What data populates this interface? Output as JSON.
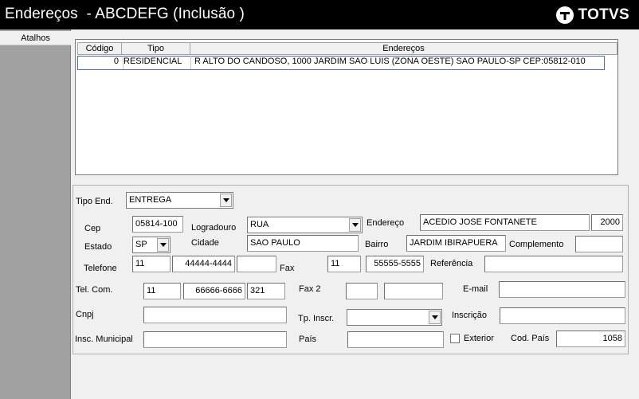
{
  "title": "Endereços  - ABCDEFG (Inclusão )",
  "logo": {
    "text": "TOTVS"
  },
  "sidebar": {
    "label": "Atalhos"
  },
  "grid": {
    "columns": [
      "Código",
      "Tipo",
      "Endereços"
    ],
    "rows": [
      {
        "codigo": "0",
        "tipo": "RESIDENCIAL",
        "endereco": "R  ALTO DO CANDOSO, 1000 JARDIM SAO LUIS (ZONA OESTE) SAO PAULO-SP CEP:05812-010"
      }
    ]
  },
  "form": {
    "tipo_end": {
      "label": "Tipo End.",
      "value": "ENTREGA"
    },
    "cep": {
      "label": "Cep",
      "value": "05814-100"
    },
    "logradouro": {
      "label": "Logradouro",
      "value": "RUA"
    },
    "endereco": {
      "label": "Endereço",
      "value": "ACEDIO JOSE FONTANETE",
      "numero": "2000"
    },
    "estado": {
      "label": "Estado",
      "value": "SP"
    },
    "cidade": {
      "label": "Cidade",
      "value": "SAO PAULO"
    },
    "bairro": {
      "label": "Bairro",
      "value": "JARDIM IBIRAPUERA"
    },
    "complemento": {
      "label": "Complemento",
      "value": ""
    },
    "telefone": {
      "label": "Telefone",
      "ddd": "11",
      "numero": "44444-4444",
      "ramal": ""
    },
    "fax": {
      "label": "Fax",
      "ddd": "11",
      "numero": "55555-5555"
    },
    "referencia": {
      "label": "Referência",
      "value": ""
    },
    "tel_com": {
      "label": "Tel. Com.",
      "ddd": "11",
      "numero": "66666-6666",
      "ramal": "321"
    },
    "fax2": {
      "label": "Fax 2",
      "ddd": "",
      "numero": ""
    },
    "email": {
      "label": "E-mail",
      "value": ""
    },
    "cnpj": {
      "label": "Cnpj",
      "value": ""
    },
    "tp_inscr": {
      "label": "Tp. Inscr.",
      "value": ""
    },
    "inscricao": {
      "label": "Inscrição",
      "value": ""
    },
    "insc_municipal": {
      "label": "Insc. Municipal",
      "value": ""
    },
    "pais": {
      "label": "País",
      "value": ""
    },
    "exterior": {
      "label": "Exterior",
      "checked": false
    },
    "cod_pais": {
      "label": "Cod. País",
      "value": "1058"
    }
  }
}
